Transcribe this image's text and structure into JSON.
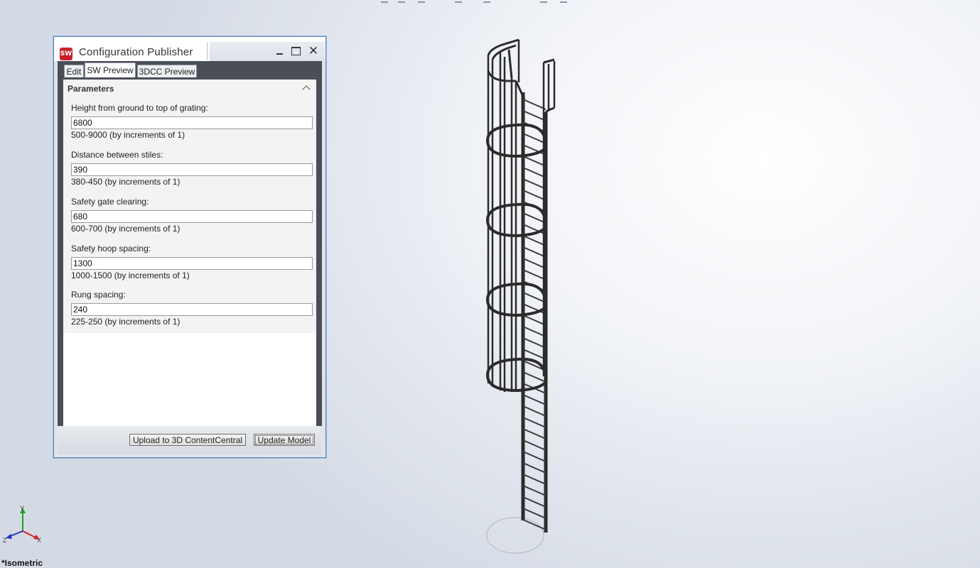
{
  "window": {
    "title": "Configuration Publisher",
    "app_icon_text": "SW"
  },
  "tabs": [
    {
      "label": "Edit",
      "active": false
    },
    {
      "label": "SW Preview",
      "active": true
    },
    {
      "label": "3DCC Preview",
      "active": false
    }
  ],
  "parameters": {
    "header": "Parameters",
    "fields": [
      {
        "label": "Height from ground to top of grating:",
        "value": "6800",
        "hint": "500-9000 (by increments of 1)"
      },
      {
        "label": "Distance between stiles:",
        "value": "390",
        "hint": "380-450 (by increments of 1)"
      },
      {
        "label": "Safety gate clearing:",
        "value": "680",
        "hint": "600-700 (by increments of 1)"
      },
      {
        "label": "Safety hoop spacing:",
        "value": "1300",
        "hint": "1000-1500 (by increments of 1)"
      },
      {
        "label": "Rung spacing:",
        "value": "240",
        "hint": "225-250 (by increments of 1)"
      }
    ]
  },
  "buttons": {
    "upload": "Upload to 3D ContentCentral",
    "update": "Update Model"
  },
  "viewport": {
    "view_name": "*Isometric",
    "triad_axes": {
      "x": "X",
      "y": "Y",
      "z": "Z"
    },
    "axis_colors": {
      "x": "#d42020",
      "y": "#1e9e2a",
      "z": "#2030c8"
    }
  }
}
